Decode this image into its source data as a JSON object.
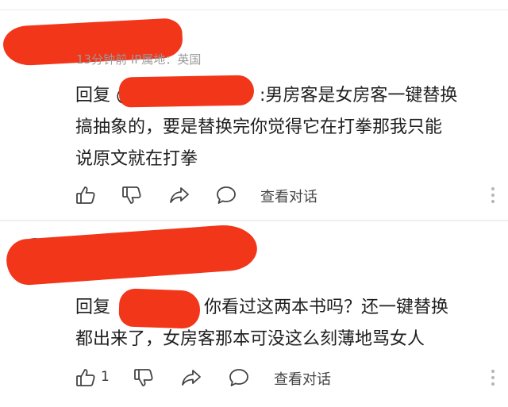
{
  "comments": [
    {
      "meta": "13分钟前 IP属地：英国",
      "lines": [
        "回复 @",
        ":男房客是女房客一键替换",
        "搞抽象的，要是替换完你觉得它在打拳那我只能",
        "说原文就在打拳"
      ],
      "like_count": "",
      "view_conversation": "查看对话"
    },
    {
      "lines": [
        "回复",
        "你看过这两本书吗？还一键替换",
        "都出来了，女房客那本可没这么刻薄地骂女人"
      ],
      "like_count": "1",
      "view_conversation": "查看对话"
    }
  ],
  "icons": {
    "like": "thumbs-up-icon",
    "dislike": "thumbs-down-icon",
    "share": "share-icon",
    "reply": "comment-bubble-icon",
    "more": "more-vertical-icon"
  },
  "colors": {
    "redaction": "#f2361a",
    "meta_text": "#9a9a9a",
    "body_text": "#1f1f1f"
  }
}
